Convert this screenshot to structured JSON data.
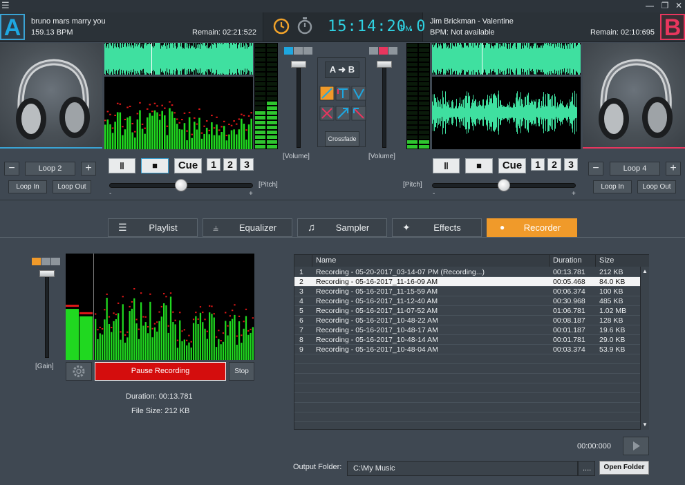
{
  "window": {
    "minimize_glyph": "—",
    "maximize_glyph": "❐",
    "close_glyph": "✕"
  },
  "deck_a": {
    "letter": "A",
    "track": "bruno mars marry you",
    "bpm": "159.13 BPM",
    "remain": "Remain: 02:21:522",
    "loop": "Loop 2",
    "loop_minus": "−",
    "loop_plus": "+",
    "loop_in": "Loop In",
    "loop_out": "Loop Out",
    "pause": "‖",
    "stop": "■",
    "cue": "Cue",
    "hotcues": [
      "1",
      "2",
      "3"
    ],
    "pitch_label": "[Pitch]",
    "pitch_minus": "-",
    "pitch_plus": "+",
    "pitch_position": 0.5
  },
  "deck_b": {
    "letter": "B",
    "track": "Jim Brickman - Valentine",
    "bpm": "BPM: Not available",
    "remain": "Remain: 02:10:695",
    "loop": "Loop 4",
    "loop_minus": "−",
    "loop_plus": "+",
    "loop_in": "Loop In",
    "loop_out": "Loop Out",
    "pause": "‖",
    "stop": "■",
    "cue": "Cue",
    "hotcues": [
      "1",
      "2",
      "3"
    ],
    "pitch_label": "[Pitch]",
    "pitch_minus": "-",
    "pitch_plus": "+",
    "pitch_position": 0.5
  },
  "clock": {
    "time": "15:14:20.0",
    "ampm": "PM"
  },
  "mixer": {
    "volume_label_left": "[Volume]",
    "volume_label_right": "[Volume]",
    "ab_button": "A ➜ B",
    "crossfade": "Crossfade"
  },
  "tabs": [
    {
      "label": "Playlist",
      "icon": "list-icon",
      "glyph": "☰"
    },
    {
      "label": "Equalizer",
      "icon": "equalizer-icon",
      "glyph": "⫨"
    },
    {
      "label": "Sampler",
      "icon": "music-note-icon",
      "glyph": "♫"
    },
    {
      "label": "Effects",
      "icon": "stars-icon",
      "glyph": "✦"
    },
    {
      "label": "Recorder",
      "icon": "microphone-icon",
      "glyph": "●"
    }
  ],
  "recorder": {
    "gain_label": "[Gain]",
    "pause_recording": "Pause Recording",
    "stop": "Stop",
    "duration": "Duration: 00:13.781",
    "file_size": "File Size: 212 KB",
    "playback_time": "00:00:000",
    "output_folder_label": "Output Folder:",
    "output_folder": "C:\\My Music",
    "browse": "....",
    "open_folder": "Open Folder",
    "level_left": 0.48,
    "level_right": 0.41
  },
  "table": {
    "headers": [
      "Name",
      "Duration",
      "Size"
    ],
    "rows": [
      {
        "num": "1",
        "name": "Recording - 05-20-2017_03-14-07 PM (Recording...)",
        "duration": "00:13.781",
        "size": "212 KB"
      },
      {
        "num": "2",
        "name": "Recording - 05-16-2017_11-16-09 AM",
        "duration": "00:05.468",
        "size": "84.0 KB"
      },
      {
        "num": "3",
        "name": "Recording - 05-16-2017_11-15-59 AM",
        "duration": "00:06.374",
        "size": "100 KB"
      },
      {
        "num": "4",
        "name": "Recording - 05-16-2017_11-12-40 AM",
        "duration": "00:30.968",
        "size": "485 KB"
      },
      {
        "num": "5",
        "name": "Recording - 05-16-2017_11-07-52 AM",
        "duration": "01:06.781",
        "size": "1.02 MB"
      },
      {
        "num": "6",
        "name": "Recording - 05-16-2017_10-48-22 AM",
        "duration": "00:08.187",
        "size": "128 KB"
      },
      {
        "num": "7",
        "name": "Recording - 05-16-2017_10-48-17 AM",
        "duration": "00:01.187",
        "size": "19.6 KB"
      },
      {
        "num": "8",
        "name": "Recording - 05-16-2017_10-48-14 AM",
        "duration": "00:01.781",
        "size": "29.0 KB"
      },
      {
        "num": "9",
        "name": "Recording - 05-16-2017_10-48-04 AM",
        "duration": "00:03.374",
        "size": "53.9 KB"
      }
    ],
    "selected_index": 1
  }
}
